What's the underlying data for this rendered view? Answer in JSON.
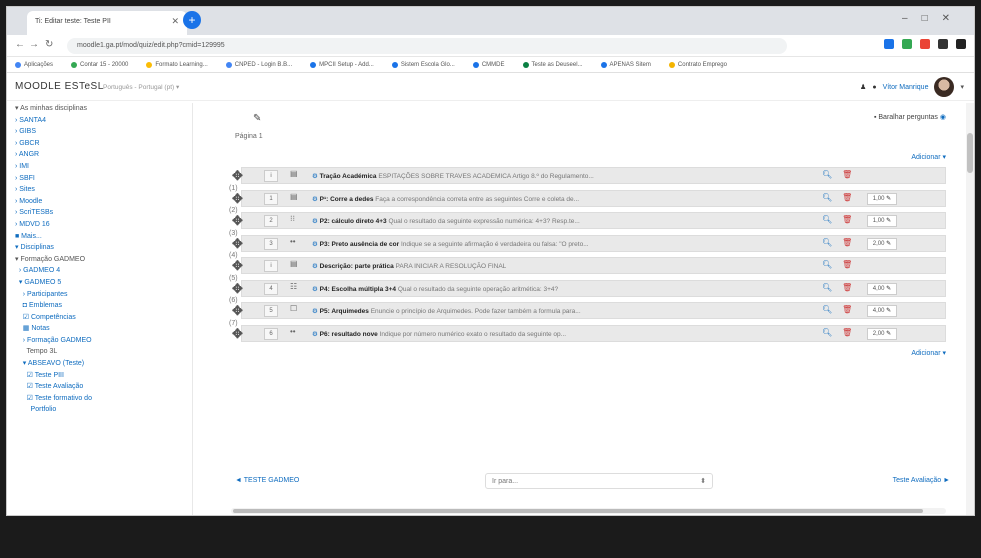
{
  "browser": {
    "tab_title": "Ti: Editar teste: Teste PII",
    "url": "moodle1.ga.pt/mod/quiz/edit.php?cmid=129995",
    "bookmarks": [
      "Aplicações",
      "Contar 15 - 20000",
      "Formato Learning...",
      "CNPED - Login B.B...",
      "MPCII Setup - Add...",
      "Sistem Escola Glo...",
      "CMMDE",
      "Teste as Deuseel...",
      "APENAS Sitem",
      "Contrato Emprego"
    ]
  },
  "moodle": {
    "brand": "MOODLE ESTeSL",
    "brand_sub": "Português - Portugal (pt) ▾",
    "user_name": "Vítor Manrique"
  },
  "sidebar": {
    "items": [
      {
        "label": "▾ As minhas disciplinas",
        "link": false
      },
      {
        "label": "› SANTA4",
        "link": true
      },
      {
        "label": "› GIBS",
        "link": true
      },
      {
        "label": "› GBCR",
        "link": true
      },
      {
        "label": "› ANGR",
        "link": true
      },
      {
        "label": "› IMI",
        "link": true
      },
      {
        "label": "› SBFI",
        "link": true
      },
      {
        "label": "› Sites",
        "link": true
      },
      {
        "label": "› Moodle",
        "link": true
      },
      {
        "label": "› ScriTESBs",
        "link": true
      },
      {
        "label": "› MDVD 16",
        "link": true
      },
      {
        "label": "■ Mais...",
        "link": true
      },
      {
        "label": "▾ Disciplinas",
        "link": true
      },
      {
        "label": "▾ Formação GADMEO",
        "link": false
      },
      {
        "label": "  › GADMEO 4",
        "link": true
      },
      {
        "label": "  ▾ GADMEO 5",
        "link": true
      },
      {
        "label": "    › Participantes",
        "link": true
      },
      {
        "label": "    ◘ Emblemas",
        "link": true
      },
      {
        "label": "    ☑ Competências",
        "link": true
      },
      {
        "label": "    ▦ Notas",
        "link": true
      },
      {
        "label": "    › Formação GADMEO",
        "link": true
      },
      {
        "label": "      Tempo 3L",
        "link": false
      },
      {
        "label": "    ▾ ABSEAVO (Teste)",
        "link": true
      },
      {
        "label": "      ☑ Teste PIII",
        "link": true
      },
      {
        "label": "      ☑ Teste Avaliação",
        "link": true
      },
      {
        "label": "      ☑ Teste formativo do",
        "link": true
      },
      {
        "label": "        Portfolio",
        "link": true
      }
    ]
  },
  "main": {
    "shuffle_label": "Baralhar perguntas",
    "page_label": "Página 1",
    "add_label": "Adicionar ▾",
    "questions": [
      {
        "num": "i",
        "icon": "▤",
        "title": "Tração Académica",
        "desc": "ESPITAÇÕES SOBRE TRAVES ACADEMICA Artigo 8.º do Regulamento...",
        "mark": ""
      },
      {
        "num": "1",
        "icon": "▤",
        "title": "P¹: Corre a dedes",
        "desc": "Faça a correspondência correta entre as seguintes Corre e coleta de...",
        "mark": "1,00"
      },
      {
        "num": "2",
        "icon": "⁝⁝",
        "title": "P2: cálculo direto 4+3",
        "desc": "Qual o resultado da seguinte expressão numérica: 4+3? Resp.te...",
        "mark": "1,00"
      },
      {
        "num": "3",
        "icon": "••",
        "title": "P3: Preto ausência de cor",
        "desc": "Indique se a seguinte afirmação é verdadeira ou falsa: \"O preto...",
        "mark": "2,00"
      },
      {
        "num": "i",
        "icon": "▤",
        "title": "Descrição: parte prática",
        "desc": "PARA INICIAR A RESOLUÇÃO FINAL",
        "mark": ""
      },
      {
        "num": "4",
        "icon": "☷",
        "title": "P4: Escolha múltipla 3+4",
        "desc": "Qual o resultado da seguinte operação aritmética: 3+4?",
        "mark": "4,00"
      },
      {
        "num": "5",
        "icon": "☐",
        "title": "P5: Arquimedes",
        "desc": "Enuncie o princípio de Arquimedes. Pode fazer também a formula para...",
        "mark": "4,00"
      },
      {
        "num": "6",
        "icon": "••",
        "title": "P6: resultado nove",
        "desc": "Indique por número numérico exato o resultado da seguinte op...",
        "mark": "2,00"
      }
    ],
    "pagebreaks": [
      "(1)",
      "(2)",
      "(3)",
      "(4)",
      "(5)",
      "(6)",
      "(7)"
    ],
    "add_bottom": "Adicionar ▾",
    "prev_link": "◄ TESTE GADMEO",
    "jump_placeholder": "Ir para...",
    "next_link": "Teste Avaliação ►"
  },
  "colors": {
    "link": "#0f6cbf",
    "delete": "#cc3333",
    "row_bg": "#e9e9e9"
  }
}
